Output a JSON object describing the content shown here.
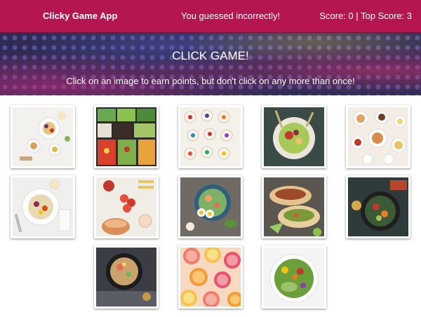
{
  "navbar": {
    "brand": "Clicky Game App",
    "message": "You guessed incorrectly!",
    "score_text": "Score: 0 | Top Score: 3"
  },
  "jumbotron": {
    "title": "CLICK GAME!",
    "subtitle": "Click on an image to earn points, but don't click on any more than once!"
  },
  "colors": {
    "navbar": "#b5164f",
    "jumbotron": "#2e2c55"
  },
  "cards": [
    {
      "subject": "breakfast spread"
    },
    {
      "subject": "salad bowls"
    },
    {
      "subject": "mini tarts"
    },
    {
      "subject": "salad plate"
    },
    {
      "subject": "brunch table"
    },
    {
      "subject": "oatmeal bowl"
    },
    {
      "subject": "tomatoes and copper pot"
    },
    {
      "subject": "poke bowl"
    },
    {
      "subject": "tacos"
    },
    {
      "subject": "vegetable skillet"
    },
    {
      "subject": "grain bowl"
    },
    {
      "subject": "citrus slices"
    },
    {
      "subject": "salad bowl"
    }
  ]
}
